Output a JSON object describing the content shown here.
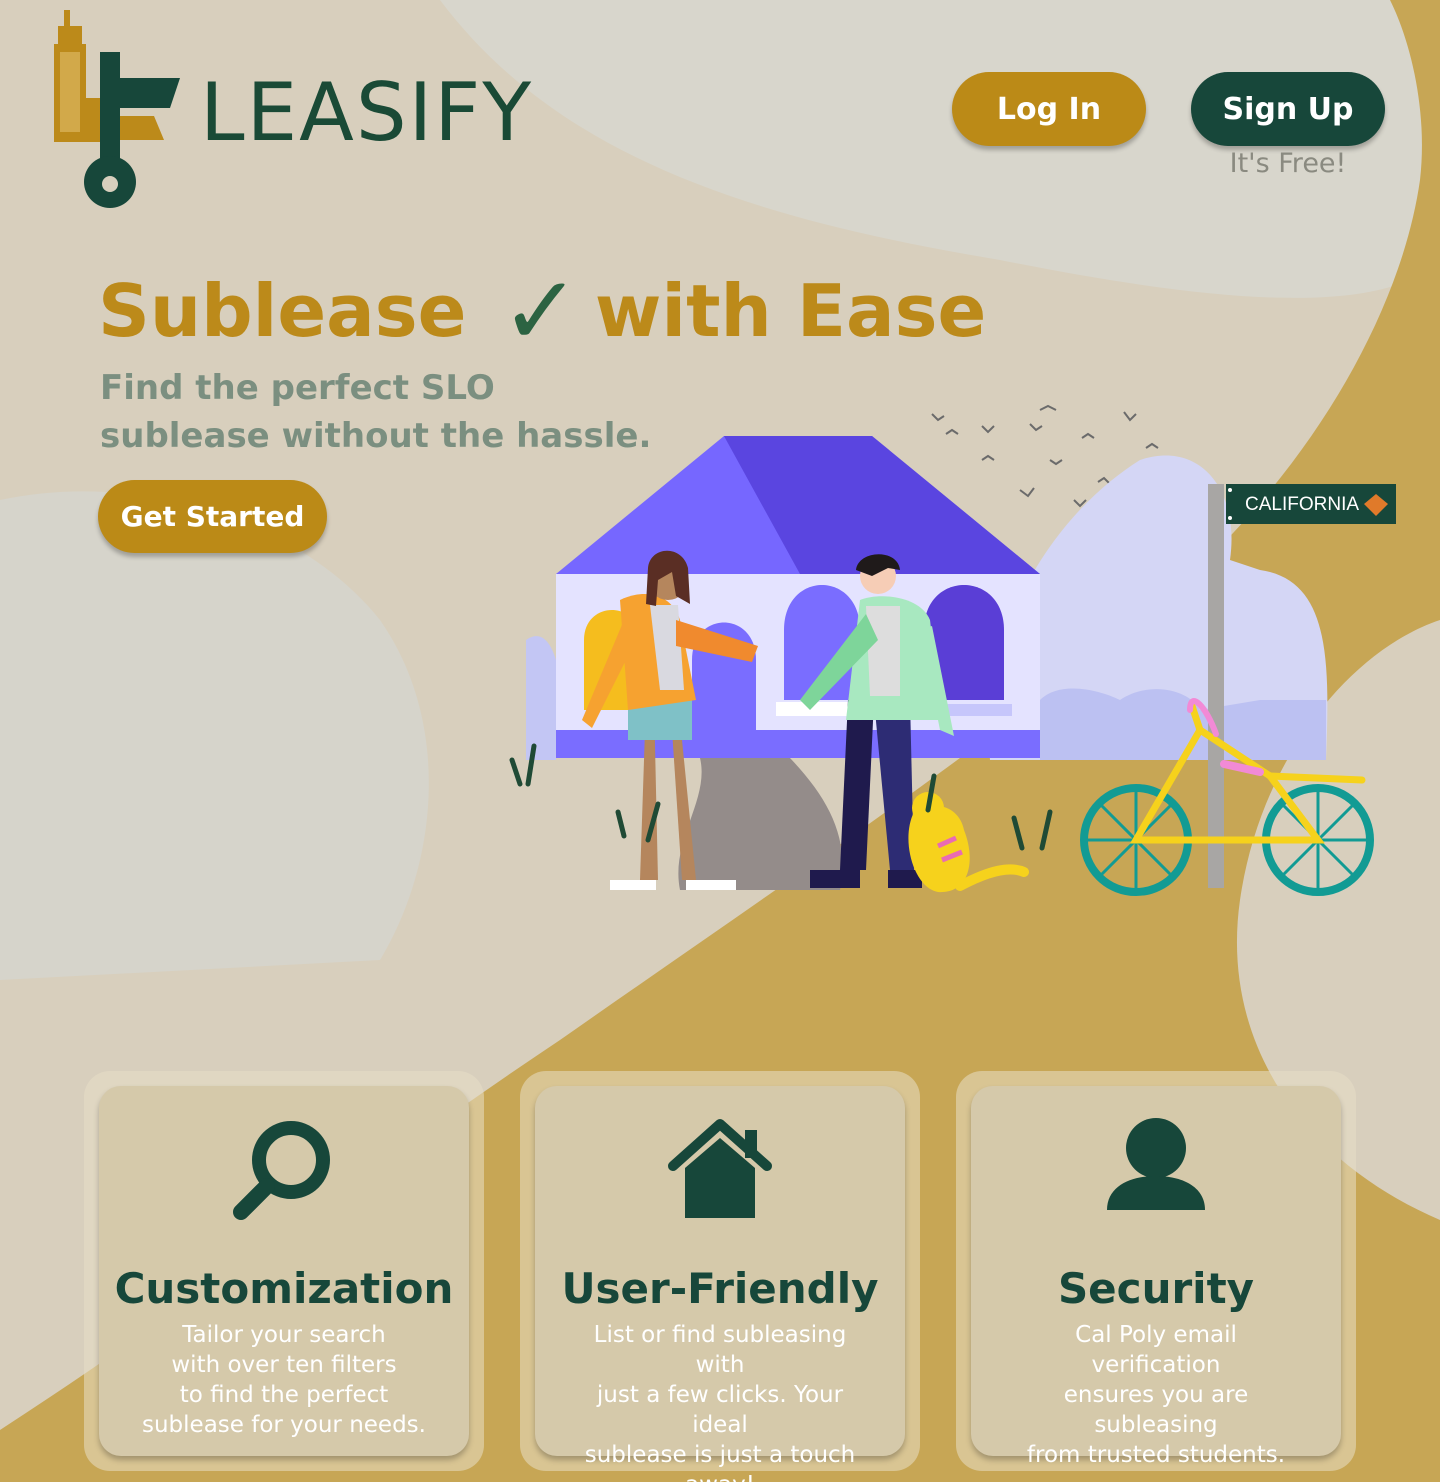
{
  "brand": {
    "name": "LEASIFY"
  },
  "header": {
    "login_label": "Log In",
    "signup_label": "Sign Up",
    "signup_note": "It's Free!"
  },
  "hero": {
    "title_part1": "Sublease",
    "title_check": "✓",
    "title_part2": "with Ease",
    "subtitle": "Find the perfect SLO sublease without the hassle.",
    "cta_label": "Get Started",
    "sign_text": "CALIFORNIA"
  },
  "features": [
    {
      "icon": "search-icon",
      "title": "Customization",
      "lines": [
        "Tailor your search",
        "with over ten filters",
        "to find the perfect",
        "sublease for your needs."
      ]
    },
    {
      "icon": "house-icon",
      "title": "User-Friendly",
      "lines": [
        "List or find subleasing with",
        "just a few clicks. Your ideal",
        "sublease is just a touch",
        "away!"
      ]
    },
    {
      "icon": "user-icon",
      "title": "Security",
      "lines": [
        "Cal Poly email verification",
        "ensures you are subleasing",
        "from trusted students."
      ]
    }
  ],
  "colors": {
    "background": "#d8cfbd",
    "gold": "#bb8a17",
    "dark_green": "#17473a",
    "path_gold": "#c7a655",
    "card": "#d5c9aa"
  }
}
